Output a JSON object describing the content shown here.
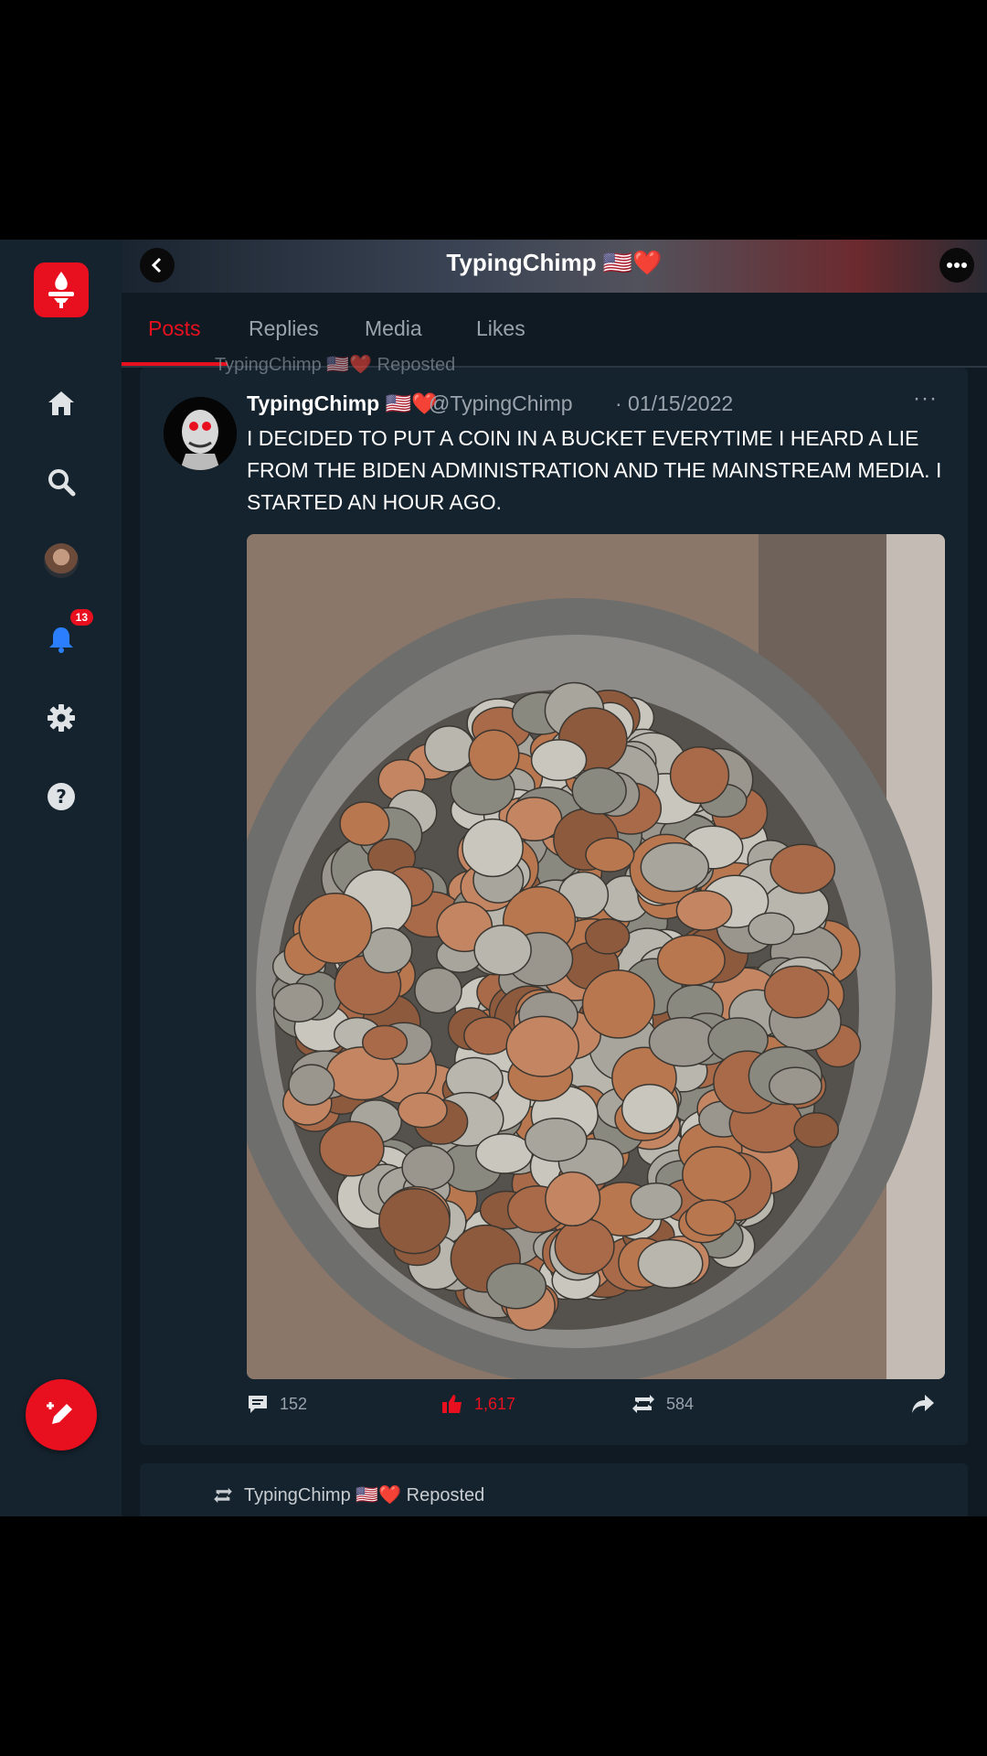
{
  "header": {
    "title": "TypingChimp 🇺🇸❤️"
  },
  "nav": {
    "notification_count": "13"
  },
  "tabs": [
    {
      "label": "Posts",
      "active": true
    },
    {
      "label": "Replies",
      "active": false
    },
    {
      "label": "Media",
      "active": false
    },
    {
      "label": "Likes",
      "active": false
    }
  ],
  "post": {
    "repost_label": "TypingChimp 🇺🇸❤️ Reposted",
    "author_name": "TypingChimp 🇺🇸❤️",
    "handle": "@TypingChimp",
    "date": "· 01/15/2022",
    "more": "···",
    "text": "I DECIDED TO PUT A COIN IN A BUCKET EVERYTIME I HEARD A LIE FROM THE BIDEN ADMINISTRATION AND THE MAINSTREAM MEDIA. I STARTED AN HOUR AGO.",
    "image_description": "bucket full of coins",
    "replies": "152",
    "likes": "1,617",
    "reposts": "584"
  },
  "next_post": {
    "repost_label": "TypingChimp 🇺🇸❤️ Reposted"
  },
  "colors": {
    "accent": "#e8101f",
    "background": "#0f1a22",
    "panel": "#15232e",
    "muted": "#9aa3ab"
  }
}
